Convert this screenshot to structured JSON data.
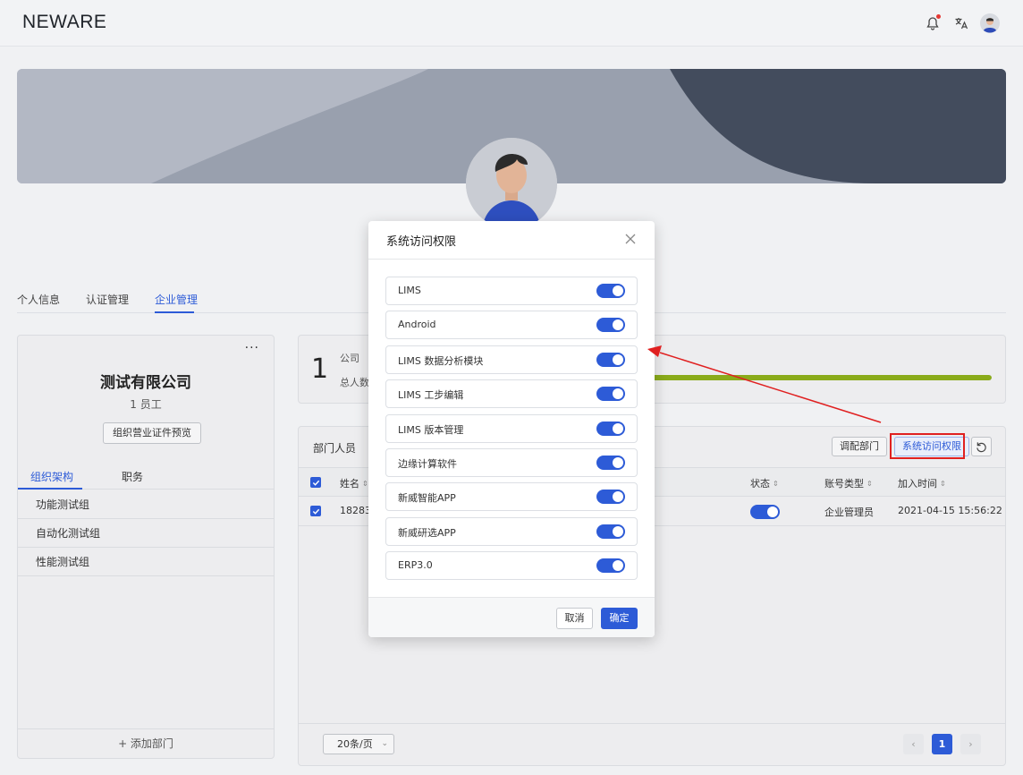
{
  "app": {
    "logo": "NEWARE"
  },
  "topbar": {
    "icons": [
      "bell-icon",
      "translate-icon",
      "user-avatar"
    ]
  },
  "profile_tabs": [
    {
      "label": "个人信息",
      "active": false
    },
    {
      "label": "认证管理",
      "active": false
    },
    {
      "label": "企业管理",
      "active": true
    }
  ],
  "company": {
    "name": "测试有限公司",
    "employee_count": "1 员工",
    "license_button": "组织营业证件预览",
    "more": "···",
    "subtabs": [
      {
        "label": "组织架构",
        "active": true
      },
      {
        "label": "职务",
        "active": false
      }
    ],
    "departments": [
      "功能测试组",
      "自动化测试组",
      "性能测试组"
    ],
    "add_department": "+ 添加部门"
  },
  "stats": {
    "number": "1",
    "company_label": "公司",
    "total_label": "总人数",
    "progress_fraction": 1.0,
    "progress_color": "#8aab1a"
  },
  "members": {
    "title": "部门人员",
    "transfer_button": "调配部门",
    "access_button": "系统访问权限",
    "columns": {
      "name": "姓名",
      "status": "状态",
      "account_type": "账号类型",
      "join_time": "加入时间"
    },
    "rows": [
      {
        "name": "182832",
        "status_on": true,
        "account_type": "企业管理员",
        "join_time": "2021-04-15 15:56:22"
      }
    ],
    "page_size": "20条/页",
    "current_page": "1",
    "prev": "‹",
    "next": "›"
  },
  "modal": {
    "title": "系统访问权限",
    "permissions": [
      {
        "label": "LIMS",
        "enabled": true
      },
      {
        "label": "Android",
        "enabled": true
      },
      {
        "label": "LIMS 数据分析模块",
        "enabled": true
      },
      {
        "label": "LIMS 工步编辑",
        "enabled": true
      },
      {
        "label": "LIMS 版本管理",
        "enabled": true
      },
      {
        "label": "边缘计算软件",
        "enabled": true
      },
      {
        "label": "新威智能APP",
        "enabled": true
      },
      {
        "label": "新威研选APP",
        "enabled": true
      },
      {
        "label": "ERP3.0",
        "enabled": true
      }
    ],
    "cancel": "取消",
    "confirm": "确定"
  },
  "colors": {
    "accent": "#2d5bd7",
    "annotation": "#e02020"
  }
}
